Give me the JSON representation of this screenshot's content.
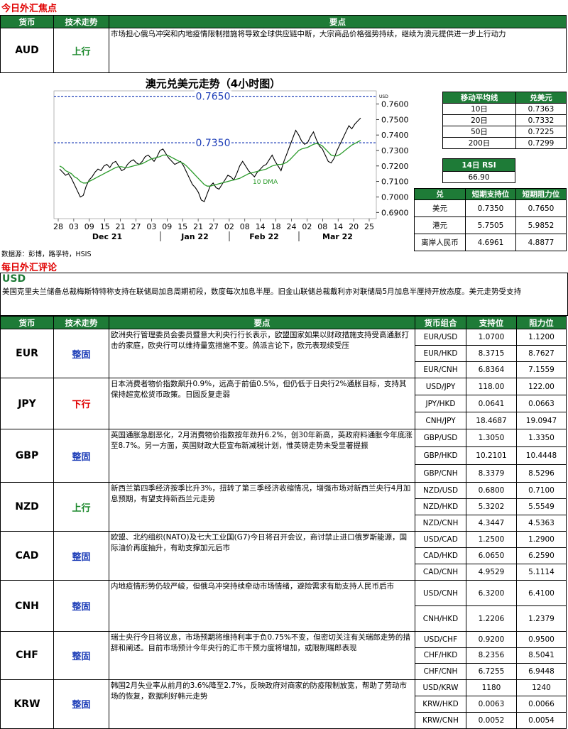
{
  "focus": {
    "section_title": "今日外汇焦点",
    "headers": [
      "货币",
      "技术走势",
      "要点"
    ],
    "currency": "AUD",
    "trend": "上行",
    "point": "市场担心俄乌冲突和内地疫情限制措施将导致全球供应链中断，大宗商品价格强势持续，继续为澳元提供进一步上行动力"
  },
  "chart_data": {
    "type": "line",
    "title": "澳元兑美元走势（4小时图）",
    "unit_label": "USD",
    "x_ticks": [
      "28",
      "03",
      "09",
      "15",
      "21",
      "27",
      "03",
      "09",
      "15",
      "21",
      "27",
      "02",
      "08",
      "14",
      "18",
      "24",
      "02",
      "08",
      "14",
      "20",
      "25"
    ],
    "x_groups": [
      "Dec 21",
      "Jan 22",
      "Feb 22",
      "Mar 22"
    ],
    "yticks": [
      "0.7600",
      "0.7500",
      "0.7400",
      "0.7300",
      "0.7200",
      "0.7100",
      "0.7000",
      "0.6900"
    ],
    "ylim": [
      0.686,
      0.7685
    ],
    "resistance_label": "0.7650",
    "resistance": 0.765,
    "support_label": "0.7350",
    "support": 0.735,
    "dma_label": "10 DMA",
    "series": [
      {
        "values": [
          0.718,
          0.716,
          0.714,
          0.715,
          0.712,
          0.708,
          0.704,
          0.7,
          0.701,
          0.707,
          0.711,
          0.713,
          0.716,
          0.718,
          0.717,
          0.72,
          0.721,
          0.719,
          0.722,
          0.723,
          0.72,
          0.717,
          0.718,
          0.721,
          0.723,
          0.724,
          0.722,
          0.721,
          0.723,
          0.726,
          0.727,
          0.725,
          0.723,
          0.726,
          0.73,
          0.731,
          0.728,
          0.725,
          0.723,
          0.721,
          0.722,
          0.723,
          0.72,
          0.716,
          0.712,
          0.708,
          0.706,
          0.703,
          0.698,
          0.697,
          0.702,
          0.707,
          0.709,
          0.706,
          0.705,
          0.708,
          0.711,
          0.714,
          0.713,
          0.711,
          0.715,
          0.72,
          0.723,
          0.72,
          0.717,
          0.715,
          0.713,
          0.716,
          0.718,
          0.72,
          0.721,
          0.724,
          0.727,
          0.723,
          0.72,
          0.717,
          0.723,
          0.728,
          0.733,
          0.738,
          0.743,
          0.74,
          0.736,
          0.734,
          0.735,
          0.739,
          0.742,
          0.737,
          0.733,
          0.731,
          0.727,
          0.723,
          0.722,
          0.725,
          0.73,
          0.734,
          0.738,
          0.742,
          0.746,
          0.744,
          0.747,
          0.749,
          0.751
        ]
      },
      {
        "values": [
          0.72,
          0.719,
          0.717,
          0.716,
          0.715,
          0.713,
          0.712,
          0.71,
          0.709,
          0.709,
          0.71,
          0.711,
          0.712,
          0.713,
          0.714,
          0.715,
          0.716,
          0.717,
          0.718,
          0.719,
          0.7195,
          0.7195,
          0.719,
          0.719,
          0.7195,
          0.72,
          0.7205,
          0.721,
          0.7215,
          0.7225,
          0.7235,
          0.7245,
          0.725,
          0.7255,
          0.726,
          0.727,
          0.727,
          0.7265,
          0.7255,
          0.7245,
          0.7235,
          0.7225,
          0.7215,
          0.72,
          0.718,
          0.716,
          0.714,
          0.712,
          0.71,
          0.708,
          0.707,
          0.707,
          0.7075,
          0.708,
          0.7085,
          0.709,
          0.7095,
          0.71,
          0.7105,
          0.711,
          0.7115,
          0.712,
          0.713,
          0.714,
          0.715,
          0.7155,
          0.716,
          0.7165,
          0.717,
          0.7175,
          0.718,
          0.719,
          0.72,
          0.7205,
          0.721,
          0.721,
          0.7215,
          0.7225,
          0.724,
          0.726,
          0.728,
          0.73,
          0.731,
          0.7315,
          0.732,
          0.733,
          0.734,
          0.7345,
          0.734,
          0.733,
          0.731,
          0.729,
          0.727,
          0.7265,
          0.7265,
          0.7275,
          0.729,
          0.7305,
          0.732,
          0.7335,
          0.7345,
          0.7355,
          0.7365
        ]
      }
    ]
  },
  "side": {
    "ma_headers": [
      "移动平均线",
      "兑美元"
    ],
    "ma_rows": [
      [
        "10日",
        "0.7363"
      ],
      [
        "20日",
        "0.7332"
      ],
      [
        "50日",
        "0.7225"
      ],
      [
        "200日",
        "0.7299"
      ]
    ],
    "rsi_label": "14日 RSI",
    "rsi_value": "66.90",
    "sr_headers": [
      "兑",
      "短期支持位",
      "短期阻力位"
    ],
    "sr_rows": [
      [
        "美元",
        "0.7350",
        "0.7650"
      ],
      [
        "港元",
        "5.7505",
        "5.9852"
      ],
      [
        "离岸人民币",
        "4.6961",
        "4.8877"
      ]
    ]
  },
  "source": "数据源：彭博，路孚特，HSIS",
  "review": {
    "section_title": "每日外汇评论",
    "usd_title": "USD",
    "usd_text": "美国克里夫兰储备总裁梅斯特特称支持在联储局加息周期初段，数度每次加息半厘。旧金山联储总裁戴利亦对联储局5月加息半厘持开放态度。美元走势受支持",
    "headers": [
      "货币",
      "技术走势",
      "要点",
      "货币组合",
      "支持位",
      "阻力位"
    ],
    "rows": [
      {
        "currency": "EUR",
        "trend": "整固",
        "cls": "flat",
        "point": "欧洲央行管理委员会委员暨意大利央行行长表示，欧盟国家如果以财政措施支持受高通胀打击的家庭，欧央行可以维持量宽措施不变。鸽派言论下，欧元表现续受压",
        "pairs": [
          [
            "EUR/USD",
            "1.0700",
            "1.1200"
          ],
          [
            "EUR/HKD",
            "8.3715",
            "8.7627"
          ],
          [
            "EUR/CNH",
            "6.8364",
            "7.1559"
          ]
        ]
      },
      {
        "currency": "JPY",
        "trend": "下行",
        "cls": "down",
        "point": "日本消费者物价指数飙升0.9%，远高于前值0.5%，但仍低于日央行2%通胀目标，支持其保持超宽松货币政策。日圆反复走弱",
        "pairs": [
          [
            "USD/JPY",
            "118.00",
            "122.00"
          ],
          [
            "JPY/HKD",
            "0.0641",
            "0.0663"
          ],
          [
            "CNH/JPY",
            "18.4687",
            "19.0947"
          ]
        ]
      },
      {
        "currency": "GBP",
        "trend": "整固",
        "cls": "flat",
        "point": "英国通胀急剧恶化，2月消费物价指数按年劲升6.2%，创30年新高，英政府料通胀今年底涨至8.7%。另一方面，英国财政大臣宣布新减税计划，惟英镑走势未受显著提振",
        "pairs": [
          [
            "GBP/USD",
            "1.3050",
            "1.3350"
          ],
          [
            "GBP/HKD",
            "10.2101",
            "10.4448"
          ],
          [
            "GBP/CNH",
            "8.3379",
            "8.5296"
          ]
        ]
      },
      {
        "currency": "NZD",
        "trend": "上行",
        "cls": "up",
        "point": "新西兰第四季经济按季比升3%，扭转了第三季经济收缩情况，增强市场对新西兰央行4月加息预期，有望支持新西兰元走势",
        "pairs": [
          [
            "NZD/USD",
            "0.6800",
            "0.7100"
          ],
          [
            "NZD/HKD",
            "5.3202",
            "5.5549"
          ],
          [
            "NZD/CNH",
            "4.3447",
            "4.5363"
          ]
        ]
      },
      {
        "currency": "CAD",
        "trend": "整固",
        "cls": "flat",
        "point": "欧盟、北约组织(NATO)及七大工业国(G7)今日将召开会议，商讨禁止进口俄罗斯能源，国际油价再度抽升，有助支撑加元后市",
        "pairs": [
          [
            "USD/CAD",
            "1.2500",
            "1.2900"
          ],
          [
            "CAD/HKD",
            "6.0650",
            "6.2590"
          ],
          [
            "CAD/CNH",
            "4.9529",
            "5.1114"
          ]
        ]
      },
      {
        "currency": "CNH",
        "trend": "整固",
        "cls": "flat",
        "point": "内地疫情形势仍较严峻，但俄乌冲突持续牵动市场情绪，避险需求有助支持人民币后市",
        "pairs": [
          [
            "USD/CNH",
            "6.3200",
            "6.4100"
          ],
          [
            "CNH/HKD",
            "1.2206",
            "1.2379"
          ]
        ]
      },
      {
        "currency": "CHF",
        "trend": "整固",
        "cls": "flat",
        "point": "瑞士央行今日将议息，市场预期将维持利率于负0.75%不变，但密切关注有关瑞郎走势的措辞和阐述。目前市场预计今年央行的汇市干预力度将增加，或限制瑞郎表现",
        "pairs": [
          [
            "USD/CHF",
            "0.9200",
            "0.9500"
          ],
          [
            "CHF/HKD",
            "8.2356",
            "8.5041"
          ],
          [
            "CHF/CNH",
            "6.7255",
            "6.9448"
          ]
        ]
      },
      {
        "currency": "KRW",
        "trend": "整固",
        "cls": "flat",
        "point": "韩国2月失业率从前月的3.6%降至2.7%，反映政府对商家的防疫限制放宽，帮助了劳动市场的恢复，数据利好韩元走势",
        "pairs": [
          [
            "USD/KRW",
            "1180",
            "1240"
          ],
          [
            "KRW/HKD",
            "0.0063",
            "0.0066"
          ],
          [
            "KRW/CNH",
            "0.0052",
            "0.0054"
          ]
        ]
      }
    ]
  }
}
